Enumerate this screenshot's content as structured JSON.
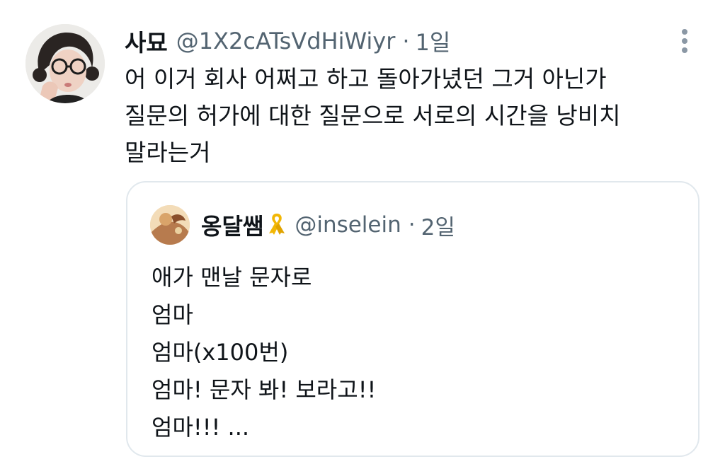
{
  "tweet": {
    "display_name": "사묘",
    "handle": "@1X2cATsVdHiWiyr",
    "separator": "·",
    "time": "1일",
    "text_lines": [
      "어 이거 회사 어쩌고 하고 돌아가녔던 그거 아닌가",
      "질문의 허가에 대한 질문으로 서로의 시간을 낭비치",
      "말라는거"
    ],
    "more_icon": "more-vertical-icon"
  },
  "quoted": {
    "display_name": "옹달쌤",
    "badge_icon": "yellow-ribbon-icon",
    "handle": "@inselein",
    "separator": "·",
    "time": "2일",
    "text_lines": [
      "애가 맨날 문자로",
      "엄마",
      "엄마(x100번)",
      "엄마! 문자 봐! 보라고!!",
      "엄마!!! ..."
    ]
  },
  "colors": {
    "text": "#0f1419",
    "secondary": "#536471",
    "border": "#e1e8ed",
    "ribbon": "#f2b705"
  }
}
